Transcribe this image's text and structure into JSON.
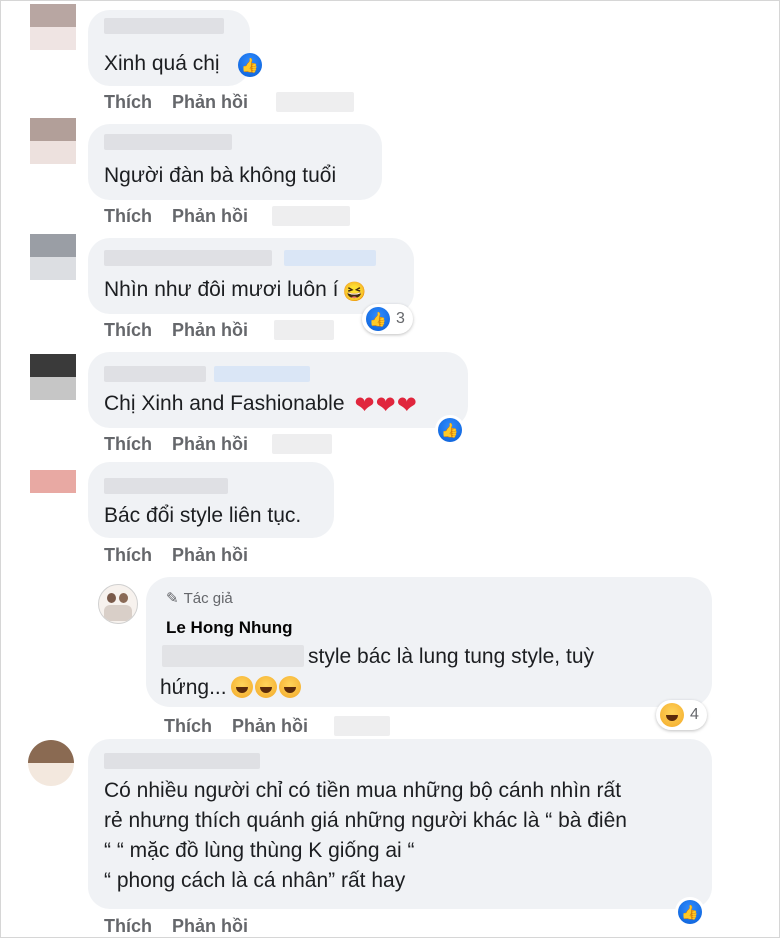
{
  "comments": [
    {
      "text": "Xinh quá chị",
      "like": "Thích",
      "reply": "Phản hồi"
    },
    {
      "text": "Người đàn bà không tuổi",
      "like": "Thích",
      "reply": "Phản hồi"
    },
    {
      "text": "Nhìn như đôi mươi luôn í",
      "like": "Thích",
      "reply": "Phản hồi",
      "reaction_count": "3"
    },
    {
      "text": "Chị Xinh and Fashionable",
      "like": "Thích",
      "reply": "Phản hồi"
    },
    {
      "text": "Bác đổi style liên tục.",
      "like": "Thích",
      "reply": "Phản hồi"
    },
    {
      "lines": [
        "Có nhiều người chỉ có tiền mua những bộ cánh nhìn rất",
        "rẻ nhưng thích quánh giá những người khác là “ bà điên",
        "“ “ mặc đồ lùng thùng K giống ai “",
        "“ phong cách là cá nhân” rất hay"
      ],
      "like": "Thích",
      "reply": "Phản hồi"
    }
  ],
  "reply": {
    "author_tag": "Tác giả",
    "author_name": "Le Hong Nhung",
    "line1": "style bác là lung tung style, tuỳ",
    "line2": "hứng...",
    "like": "Thích",
    "reply": "Phản hồi",
    "reaction_count": "4"
  },
  "icons": {
    "like": "thumbs-up-icon",
    "haha": "laughing-face-icon",
    "heart": "heart-icon",
    "author": "pencil-icon"
  },
  "colors": {
    "bubble": "#f0f2f5",
    "action_text": "#65676b",
    "like_blue": "#1877f2",
    "heart_red": "#e0263d"
  }
}
